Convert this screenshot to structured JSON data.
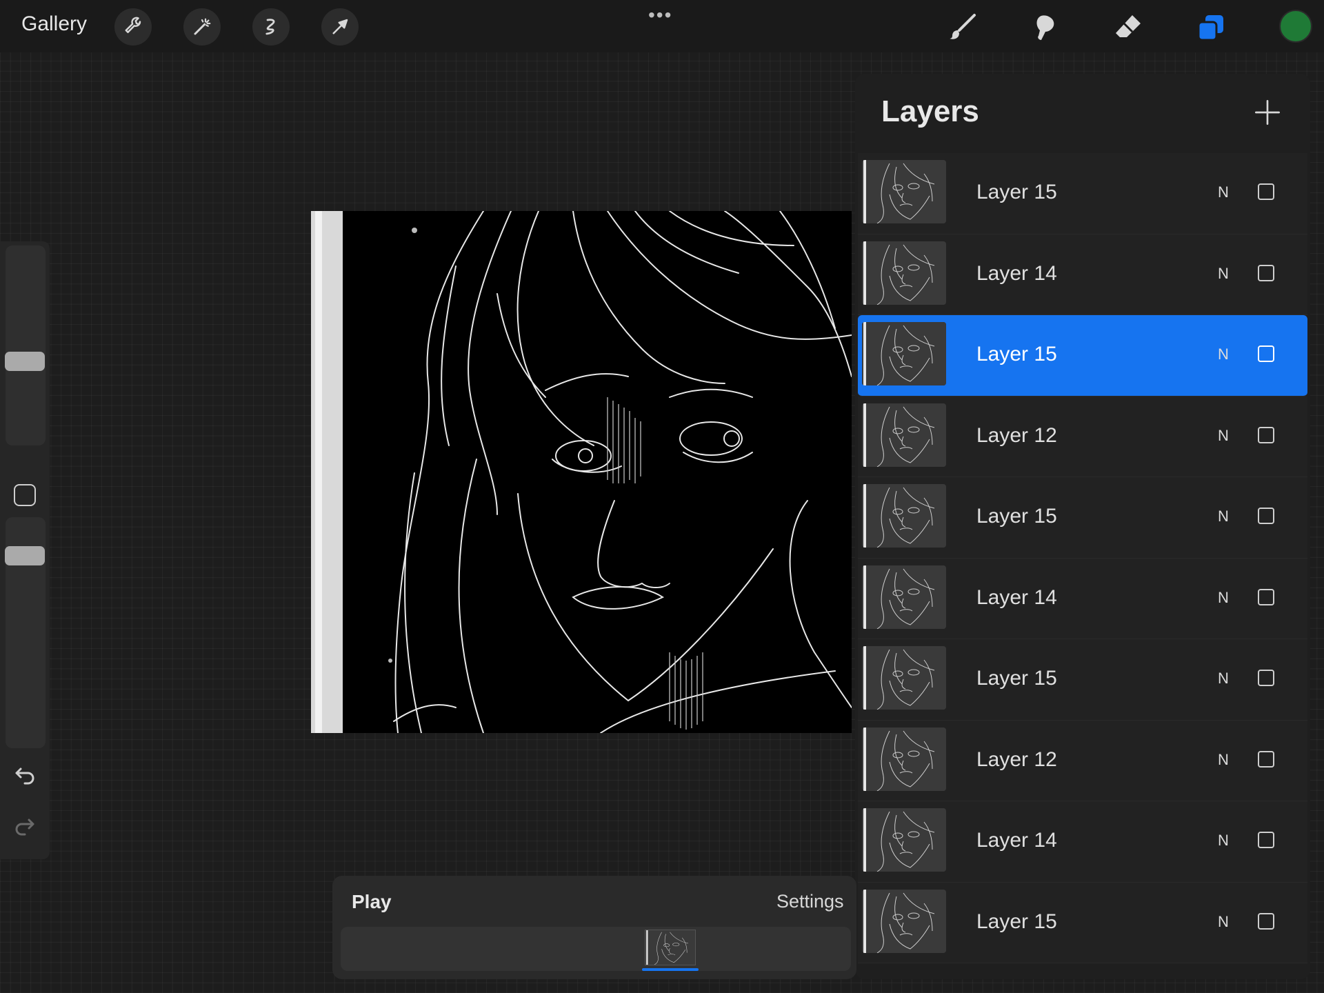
{
  "topbar": {
    "gallery_label": "Gallery",
    "more_dots": "•••",
    "left_tools": [
      "wrench-icon",
      "magic-wand-icon",
      "selection-icon",
      "transform-arrow-icon"
    ],
    "right_tools": [
      "brush-icon",
      "smudge-icon",
      "eraser-icon",
      "layers-icon"
    ],
    "color_swatch": "#1f7a36",
    "accent": "#1674f0"
  },
  "sidebar": {
    "brush_size_level": 0.54,
    "opacity_level": 0.95
  },
  "layers": {
    "title": "Layers",
    "items": [
      {
        "name": "Layer 15",
        "blend": "N",
        "selected": false
      },
      {
        "name": "Layer 14",
        "blend": "N",
        "selected": false
      },
      {
        "name": "Layer 15",
        "blend": "N",
        "selected": true
      },
      {
        "name": "Layer 12",
        "blend": "N",
        "selected": false
      },
      {
        "name": "Layer 15",
        "blend": "N",
        "selected": false
      },
      {
        "name": "Layer 14",
        "blend": "N",
        "selected": false
      },
      {
        "name": "Layer 15",
        "blend": "N",
        "selected": false
      },
      {
        "name": "Layer 12",
        "blend": "N",
        "selected": false
      },
      {
        "name": "Layer 14",
        "blend": "N",
        "selected": false
      },
      {
        "name": "Layer 15",
        "blend": "N",
        "selected": false
      }
    ]
  },
  "animation": {
    "play_label": "Play",
    "settings_label": "Settings"
  }
}
